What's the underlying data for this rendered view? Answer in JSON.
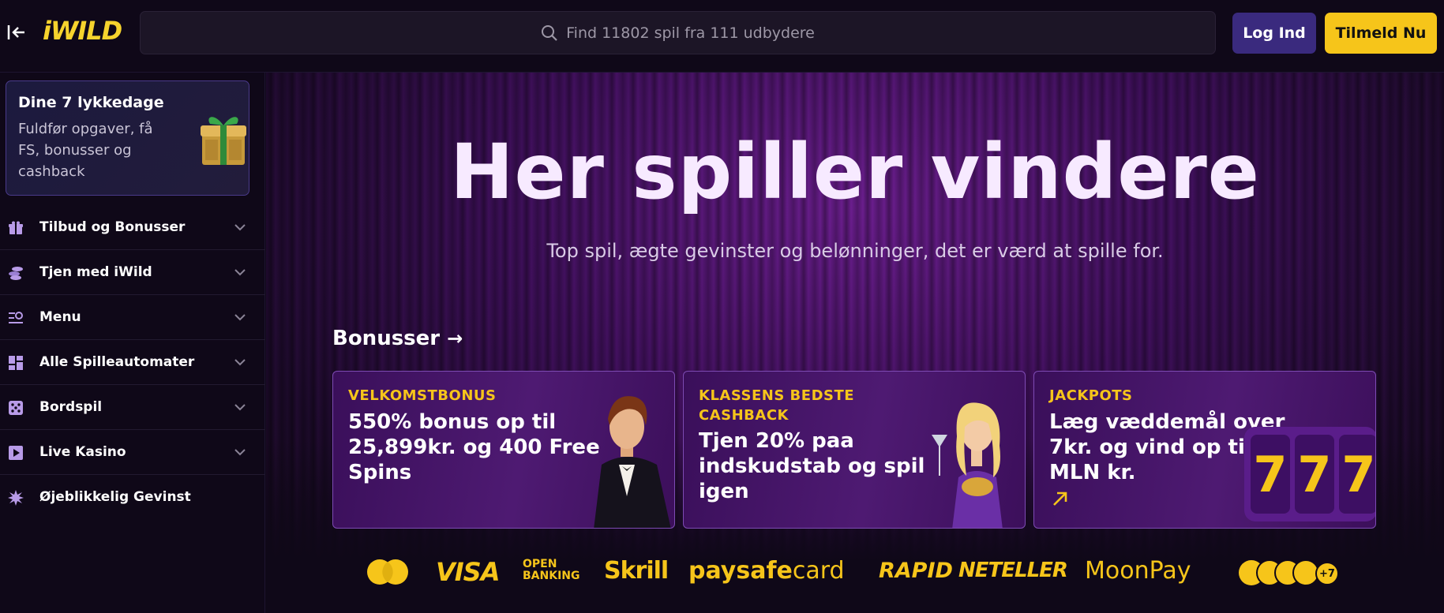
{
  "header": {
    "logo": "iWILD",
    "search_placeholder": "Find 11802 spil fra 111 udbydere",
    "login_label": "Log Ind",
    "signup_label": "Tilmeld Nu"
  },
  "sidebar": {
    "promo": {
      "title": "Dine 7 lykkedage",
      "description": "Fuldfør opgaver, få FS, bonusser og cashback"
    },
    "items": [
      {
        "label": "Tilbud og Bonusser",
        "icon": "gift-icon"
      },
      {
        "label": "Tjen med iWild",
        "icon": "coins-icon"
      },
      {
        "label": "Menu",
        "icon": "menu-search-icon"
      },
      {
        "label": "Alle Spilleautomater",
        "icon": "grid-icon"
      },
      {
        "label": "Bordspil",
        "icon": "dice-icon"
      },
      {
        "label": "Live Kasino",
        "icon": "play-icon"
      },
      {
        "label": "Øjeblikkelig Gevinst",
        "icon": "burst-icon"
      }
    ]
  },
  "hero": {
    "title": "Her spiller vindere",
    "subtitle": "Top spil, ægte gevinster og belønninger, det er værd at spille for."
  },
  "bonuses": {
    "section_title": "Bonusser",
    "cards": [
      {
        "kicker": "VELKOMSTBONUS",
        "body": "550% bonus op til 25,899kr. og 400 Free Spins"
      },
      {
        "kicker": "KLASSENS BEDSTE CASHBACK",
        "body": "Tjen 20% paa indskudstab og spil igen"
      },
      {
        "kicker": "JACKPOTS",
        "body": "Læg væddemål over 7kr. og vind op til 6 MLN kr."
      }
    ]
  },
  "payments": {
    "visa": "VISA",
    "open_banking": "OPEN BANKING",
    "skrill": "Skrill",
    "paysafe_a": "paysafe",
    "paysafe_b": "card",
    "rapid": "RAPID",
    "neteller": "NETELLER",
    "moonpay": "MoonPay",
    "crypto_more": "+7"
  },
  "colors": {
    "accent": "#f6c51a",
    "brand_purple": "#3a2a7e",
    "background": "#0f0818"
  }
}
